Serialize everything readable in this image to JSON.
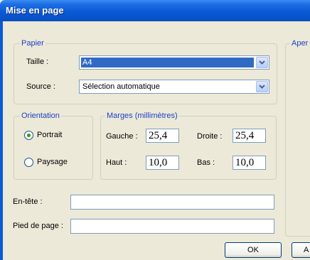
{
  "window": {
    "title": "Mise en page"
  },
  "paper": {
    "legend": "Papier",
    "size": {
      "label": "Taille :",
      "value": "A4"
    },
    "source": {
      "label": "Source :",
      "value": "Sélection automatique"
    }
  },
  "preview": {
    "legend": "Aper"
  },
  "orientation": {
    "legend": "Orientation",
    "options": [
      {
        "label": "Portrait",
        "selected": true
      },
      {
        "label": "Paysage",
        "selected": false
      }
    ]
  },
  "margins": {
    "legend": "Marges (millimètres)",
    "left": {
      "label": "Gauche :",
      "value": "25,4"
    },
    "right": {
      "label": "Droite :",
      "value": "25,4"
    },
    "top": {
      "label": "Haut :",
      "value": "10,0"
    },
    "bottom": {
      "label": "Bas :",
      "value": "10,0"
    }
  },
  "header": {
    "label": "En-tête :",
    "value": ""
  },
  "footer": {
    "label": "Pied de page :",
    "value": ""
  },
  "buttons": {
    "ok": "OK",
    "second": "A"
  },
  "colors": {
    "titlebar": "#0a5ad6",
    "dialog": "#ece9d8",
    "legend_text": "#1d3fc5",
    "selection": "#316ac5"
  }
}
